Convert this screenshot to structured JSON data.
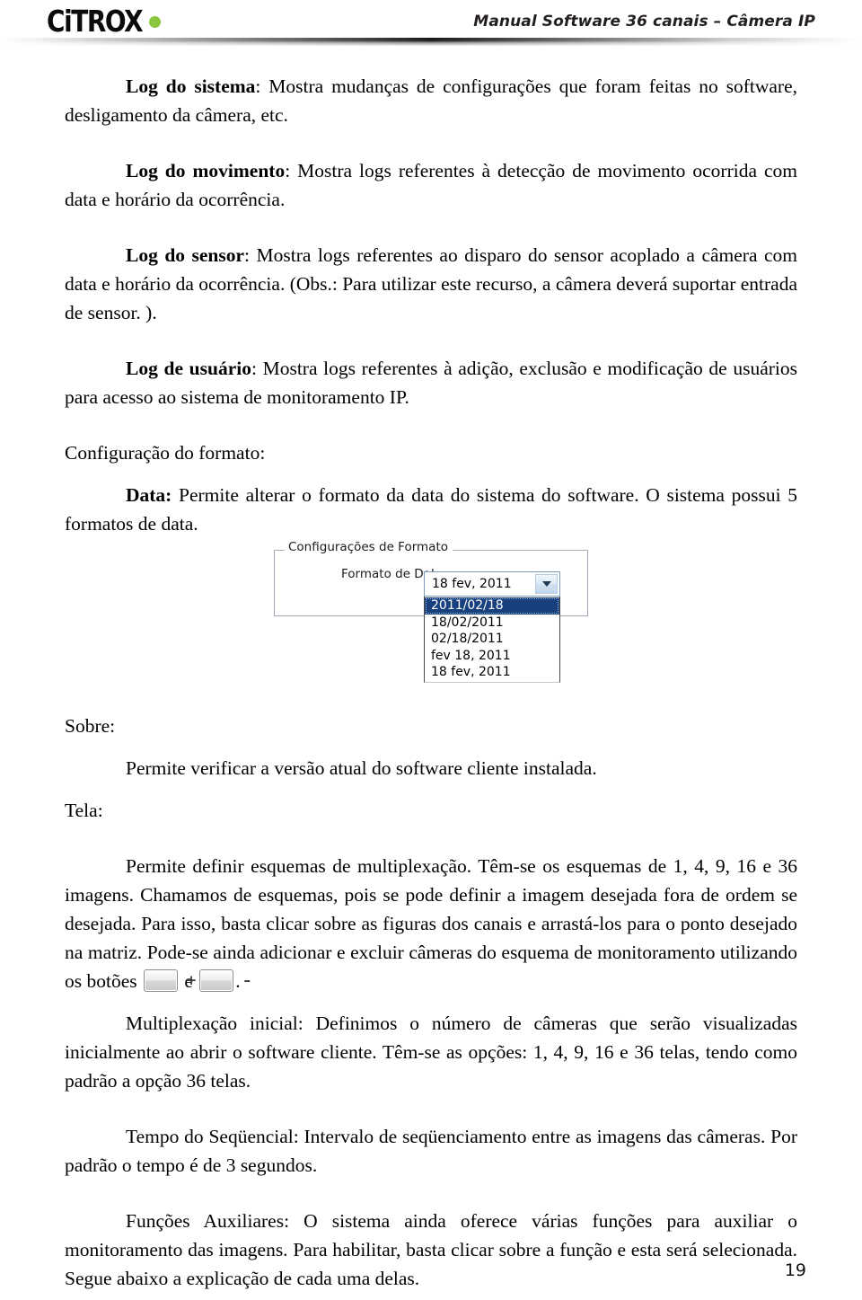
{
  "header": {
    "logo_text": "CiTROX",
    "logo_dot_color": "#8cc63e",
    "title": "Manual Software 36 canais – Câmera IP"
  },
  "body": {
    "p1_bold": "Log do sistema",
    "p1_rest": ": Mostra mudanças de configurações que  foram  feitas no software, desligamento da câmera, etc.",
    "p2_bold": "Log do movimento",
    "p2_rest": ": Mostra logs referentes à detecção de movimento ocorrida com data e horário da ocorrência.",
    "p3_bold": "Log do sensor",
    "p3_rest": ": Mostra logs referentes ao disparo do sensor acoplado a câmera com data e horário da ocorrência. (Obs.: Para utilizar este recurso, a câmera deverá suportar entrada de sensor. ).",
    "p4_bold": "Log de usuário",
    "p4_rest": ": Mostra logs referentes à adição, exclusão e modificação de usuários para acesso ao sistema de monitoramento IP.",
    "p5": "Configuração do formato:",
    "p6_bold": "Data:",
    "p6_rest": " Permite alterar o formato da data do sistema do software. O sistema possui 5 formatos de data.",
    "p7": "Sobre:",
    "p8": "Permite verificar  a versão atual do software cliente instalada.",
    "p9": "Tela:",
    "p10_a": "Permite definir esquemas de multiplexação. Têm-se os esquemas de 1, 4, 9, 16  e 36 imagens. Chamamos de esquemas, pois se pode definir a imagem desejada fora de ordem se desejada. Para isso, basta clicar sobre as figuras dos canais e arrastá-los para o ponto desejado na matriz. Pode-se ainda adicionar e excluir câmeras do esquema de monitoramento utilizando os botões ",
    "p10_btn_plus": "+",
    "p10_mid": " e ",
    "p10_btn_minus": "–",
    "p10_end": ".",
    "p11": "Multiplexação inicial: Definimos o número de câmeras que serão visualizadas inicialmente ao abrir o software cliente. Têm-se as opções: 1, 4, 9, 16 e 36 telas, tendo como padrão a opção 36 telas.",
    "p12": "Tempo do Seqüencial: Intervalo de seqüenciamento entre as imagens das câmeras. Por padrão o tempo é de 3 segundos.",
    "p13": "Funções Auxiliares: O sistema ainda oferece várias funções para auxiliar o monitoramento das imagens. Para habilitar, basta clicar sobre a função e esta será selecionada. Segue abaixo a explicação de cada uma delas."
  },
  "screenshot": {
    "groupbox_legend": "Configurações de Formato",
    "field_label": "Formato de Dal",
    "combo_value": "18 fev, 2011",
    "combo_arrow_icon": "chevron-down-icon",
    "options": [
      "2011/02/18",
      "18/02/2011",
      "02/18/2011",
      "fev 18, 2011",
      "18 fev, 2011"
    ],
    "selected_index": 0,
    "selection_color": "#18407f"
  },
  "footer": {
    "page_number": "19"
  }
}
